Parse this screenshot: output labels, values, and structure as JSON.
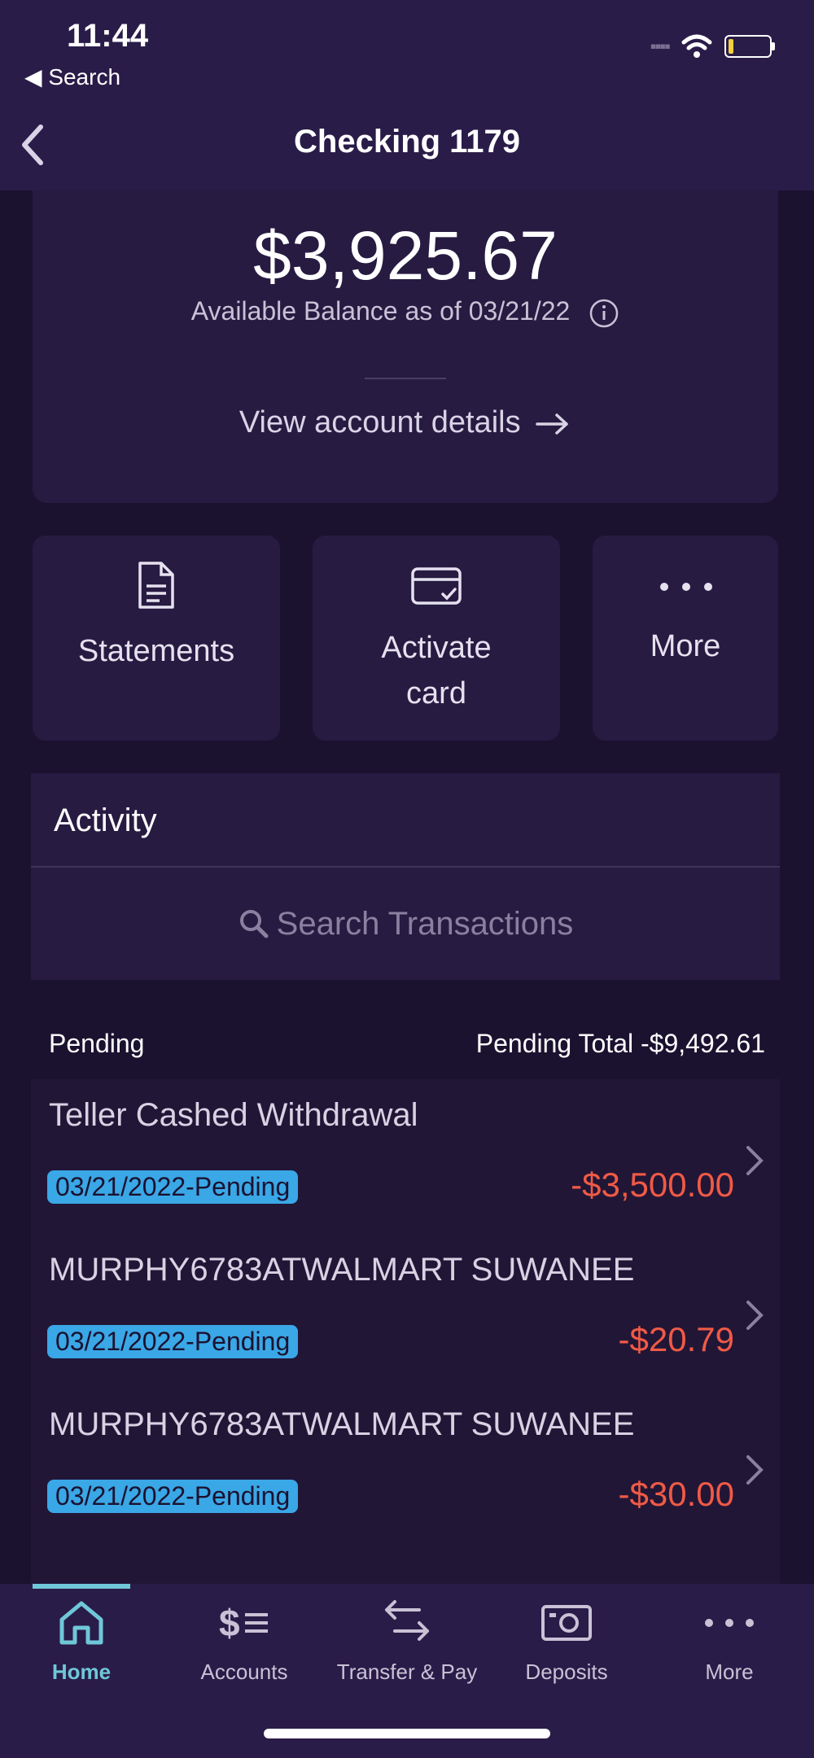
{
  "status": {
    "time": "11:44",
    "back_label": "◀ Search"
  },
  "header": {
    "title": "Checking 1179"
  },
  "balance": {
    "amount": "$3,925.67",
    "caption": "Available Balance as of 03/21/22",
    "details_link": "View account details"
  },
  "actions": [
    {
      "label": "Statements"
    },
    {
      "label": "Activate card"
    },
    {
      "label": "More"
    }
  ],
  "activity": {
    "title": "Activity",
    "search_placeholder": "Search Transactions",
    "pending_label": "Pending",
    "pending_total": "Pending Total -$9,492.61"
  },
  "transactions": [
    {
      "name": "Teller Cashed Withdrawal",
      "status": "03/21/2022-Pending",
      "amount": "-$3,500.00"
    },
    {
      "name": "MURPHY6783ATWALMART SUWANEE",
      "status": "03/21/2022-Pending",
      "amount": "-$20.79"
    },
    {
      "name": "MURPHY6783ATWALMART SUWANEE",
      "status": "03/21/2022-Pending",
      "amount": "-$30.00"
    }
  ],
  "nav": [
    {
      "label": "Home",
      "icon": "home-icon",
      "active": true
    },
    {
      "label": "Accounts",
      "icon": "accounts-icon"
    },
    {
      "label": "Transfer & Pay",
      "icon": "transfer-icon"
    },
    {
      "label": "Deposits",
      "icon": "camera-icon"
    },
    {
      "label": "More",
      "icon": "more-icon"
    }
  ],
  "colors": {
    "accent": "#6fc7d8",
    "negative": "#f05a45",
    "badge": "#3aa7e6",
    "background": "#1b1230"
  }
}
